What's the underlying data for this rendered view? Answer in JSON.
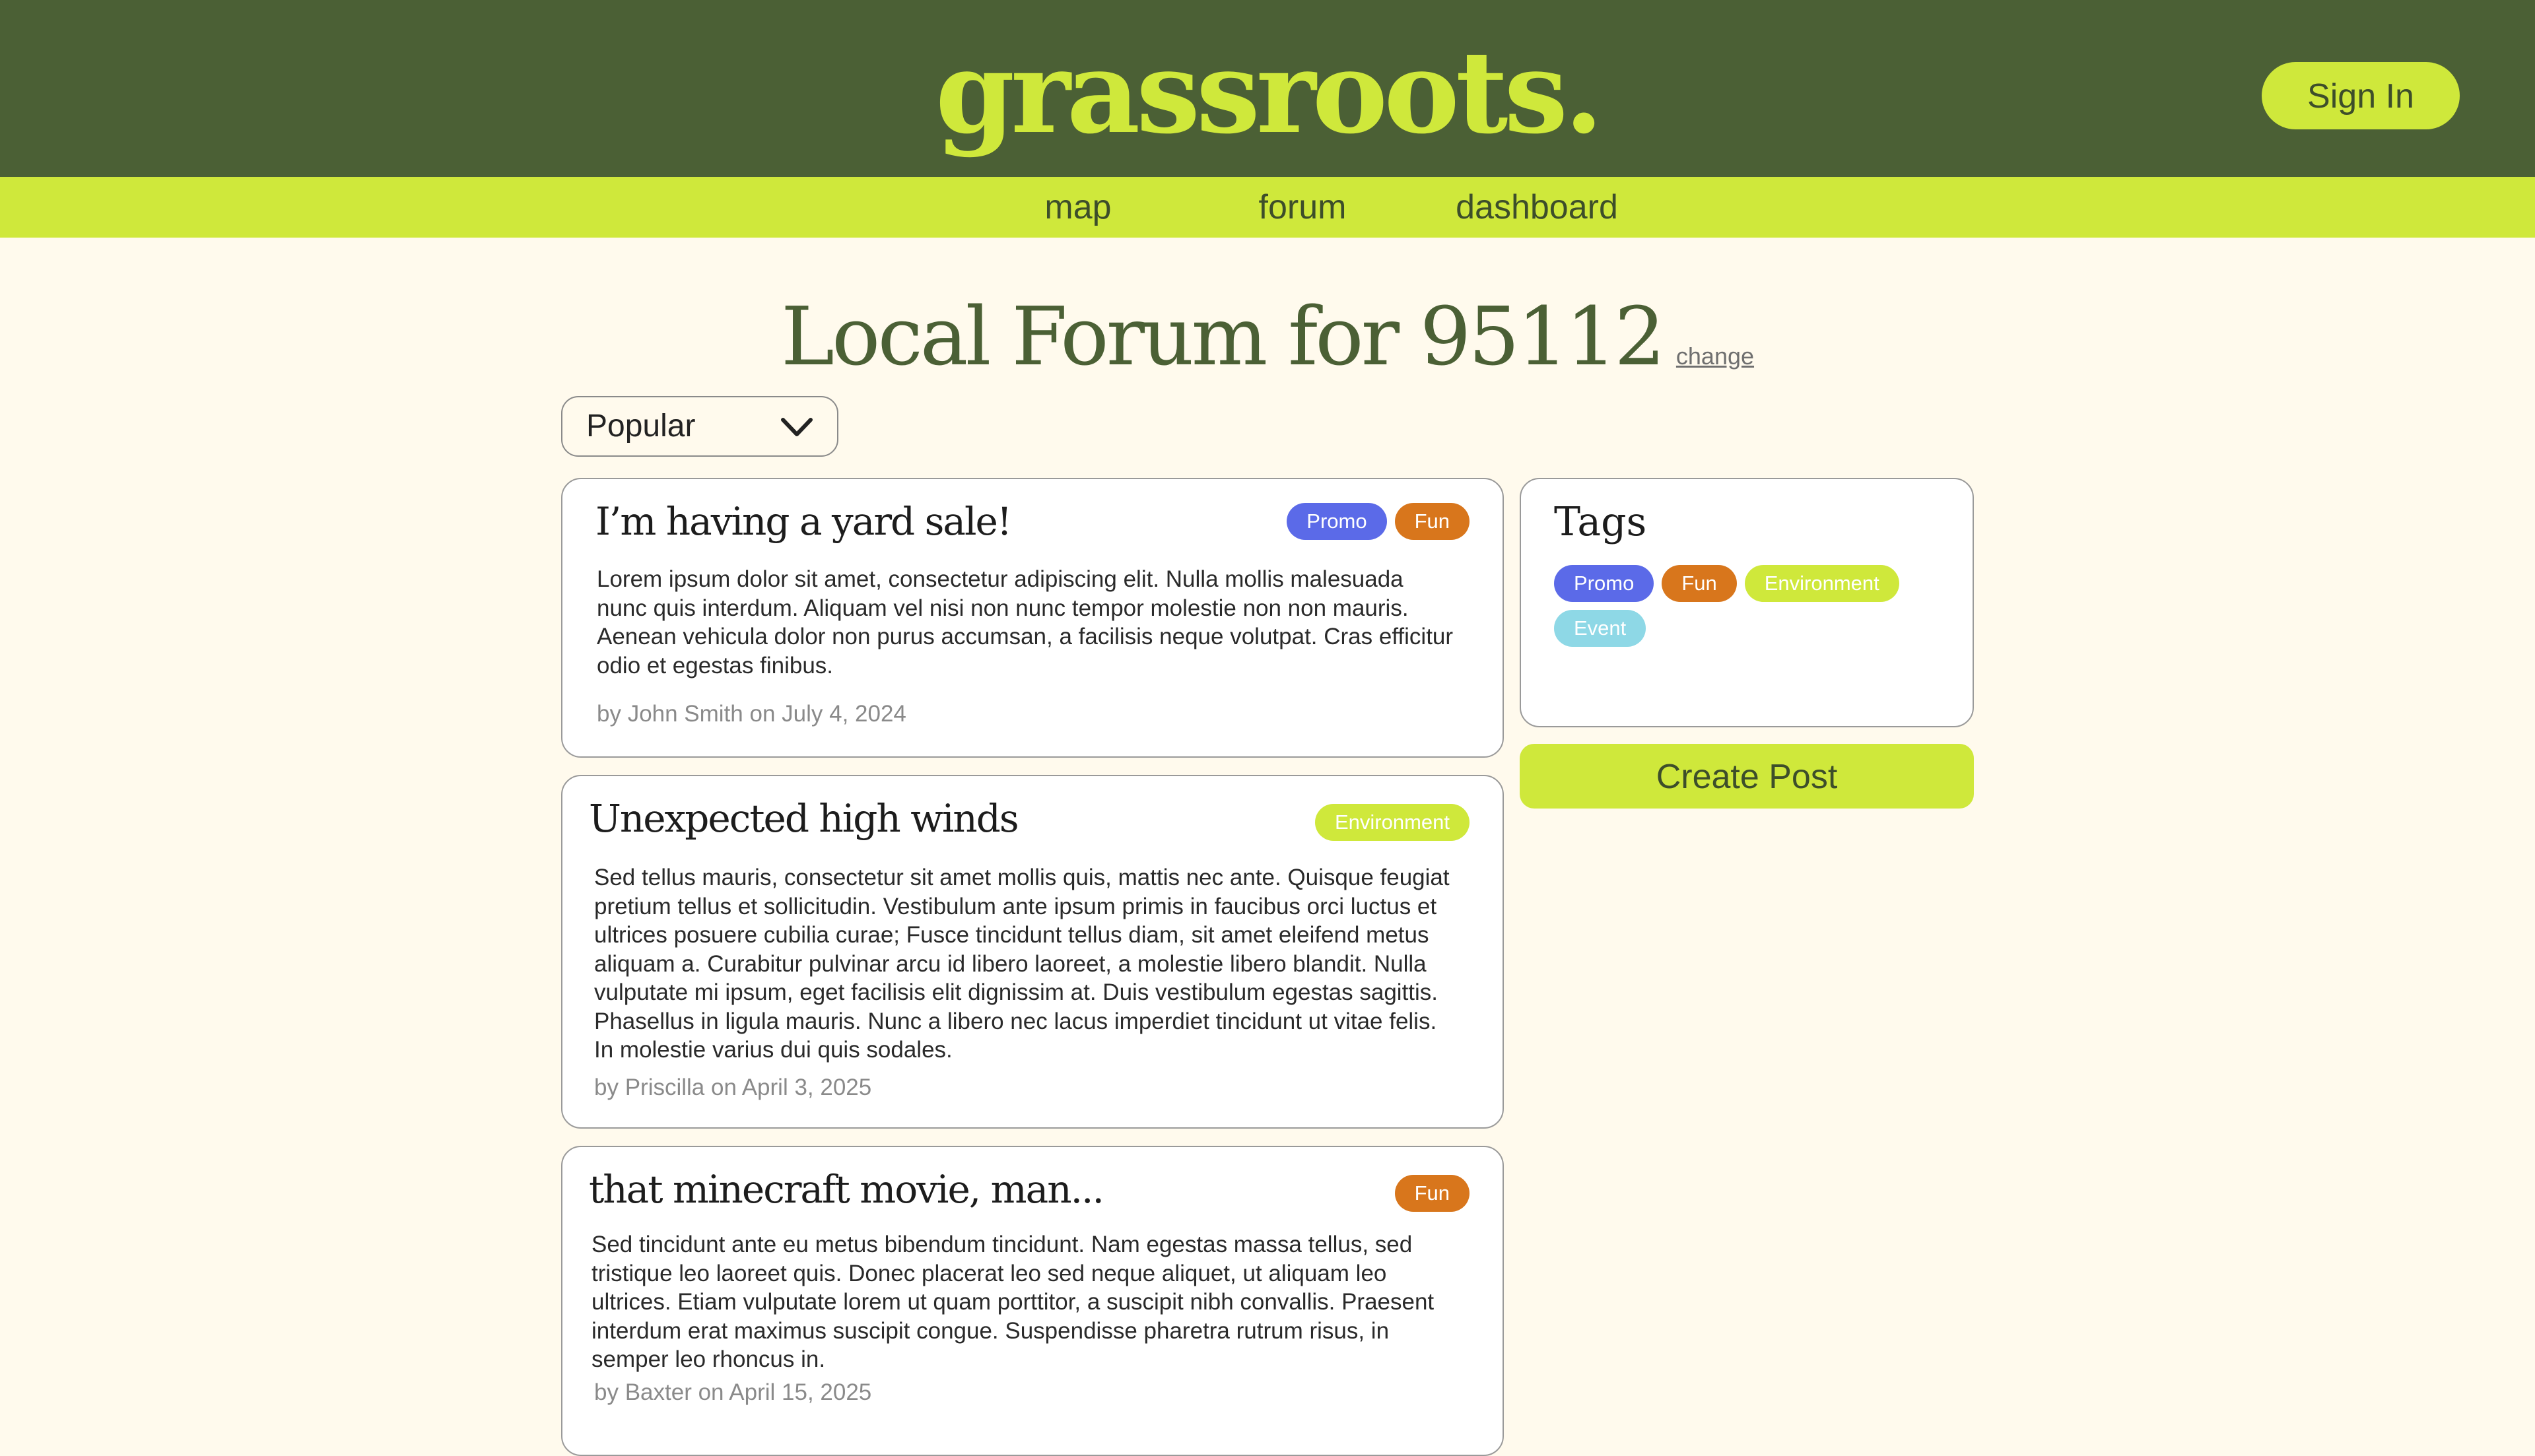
{
  "header": {
    "logo": "grassroots.",
    "sign_in_label": "Sign In",
    "background_color": "#4b6035",
    "accent_color": "#cfe83b"
  },
  "nav": {
    "items": [
      {
        "label": "map"
      },
      {
        "label": "forum"
      },
      {
        "label": "dashboard"
      }
    ]
  },
  "page": {
    "title": "Local Forum for 95112",
    "change_label": "change"
  },
  "sort": {
    "selected": "Popular",
    "icon": "chevron-down-icon"
  },
  "posts": [
    {
      "title": "I’m having a yard sale!",
      "tags": [
        "Promo",
        "Fun"
      ],
      "body": "Lorem ipsum dolor sit amet, consectetur adipiscing elit. Nulla mollis malesuada nunc quis interdum. Aliquam vel nisi non nunc tempor molestie non non mauris. Aenean vehicula dolor non purus accumsan, a facilisis neque volutpat. Cras efficitur odio et egestas finibus.",
      "meta": "by John Smith on July 4, 2024"
    },
    {
      "title": "Unexpected high winds",
      "tags": [
        "Environment"
      ],
      "body": "Sed tellus mauris, consectetur sit amet mollis quis, mattis nec ante. Quisque feugiat pretium tellus et sollicitudin. Vestibulum ante ipsum primis in faucibus orci luctus et ultrices posuere cubilia curae; Fusce tincidunt tellus diam, sit amet eleifend metus aliquam a. Curabitur pulvinar arcu id libero laoreet, a molestie libero blandit. Nulla vulputate mi ipsum, eget facilisis elit dignissim at. Duis vestibulum egestas sagittis. Phasellus in ligula mauris. Nunc a libero nec lacus imperdiet tincidunt ut vitae felis. In molestie varius dui quis sodales.",
      "meta": "by Priscilla on April 3, 2025"
    },
    {
      "title": "that minecraft movie, man...",
      "tags": [
        "Fun"
      ],
      "body": "Sed tincidunt ante eu metus bibendum tincidunt. Nam egestas massa tellus, sed tristique leo laoreet quis. Donec placerat leo sed neque aliquet, ut aliquam leo ultrices. Etiam vulputate lorem ut quam porttitor, a suscipit nibh convallis. Praesent interdum erat maximus suscipit congue. Suspendisse pharetra rutrum risus, in semper leo rhoncus in.",
      "meta": "by Baxter on April 15, 2025"
    }
  ],
  "tags_panel": {
    "title": "Tags",
    "tags": [
      "Promo",
      "Fun",
      "Environment",
      "Event"
    ]
  },
  "tag_colors": {
    "Promo": "#5b6ae8",
    "Fun": "#d8761c",
    "Environment": "#cfe83b",
    "Event": "#8ed8e6"
  },
  "create_post_label": "Create Post"
}
